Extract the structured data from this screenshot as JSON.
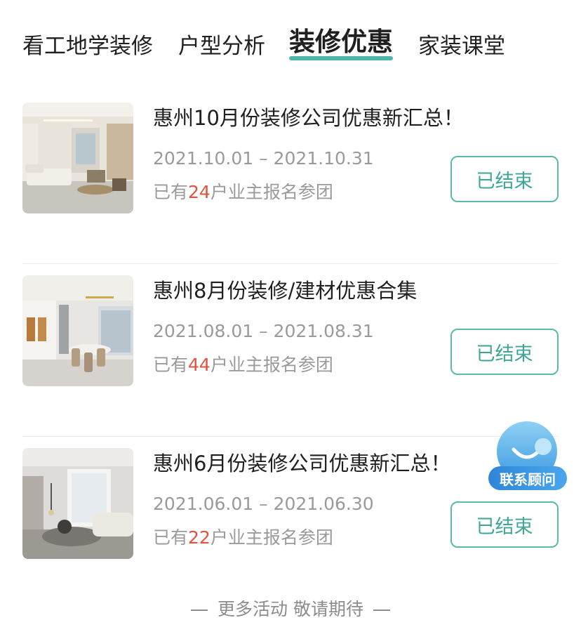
{
  "tabs": [
    {
      "label": "看工地学装修",
      "active": false
    },
    {
      "label": "户型分析",
      "active": false
    },
    {
      "label": "装修优惠",
      "active": true
    },
    {
      "label": "家装课堂",
      "active": false
    }
  ],
  "promotions": [
    {
      "title": "惠州10月份装修公司优惠新汇总！",
      "dates": "2021.10.01 – 2021.10.31",
      "signup_prefix": "已有",
      "signup_count": "24",
      "signup_suffix": "户业主报名参团",
      "status": "已结束"
    },
    {
      "title": "惠州8月份装修/建材优惠合集",
      "dates": "2021.08.01 – 2021.08.31",
      "signup_prefix": "已有",
      "signup_count": "44",
      "signup_suffix": "户业主报名参团",
      "status": "已结束"
    },
    {
      "title": "惠州6月份装修公司优惠新汇总！",
      "dates": "2021.06.01 – 2021.06.30",
      "signup_prefix": "已有",
      "signup_count": "22",
      "signup_suffix": "户业主报名参团",
      "status": "已结束"
    }
  ],
  "footer": {
    "text": "更多活动 敬请期待"
  },
  "advisor": {
    "label": "联系顾问"
  },
  "colors": {
    "accent": "#4fb5a6",
    "count": "#e0543f",
    "advisor": "#3b9ae0"
  }
}
